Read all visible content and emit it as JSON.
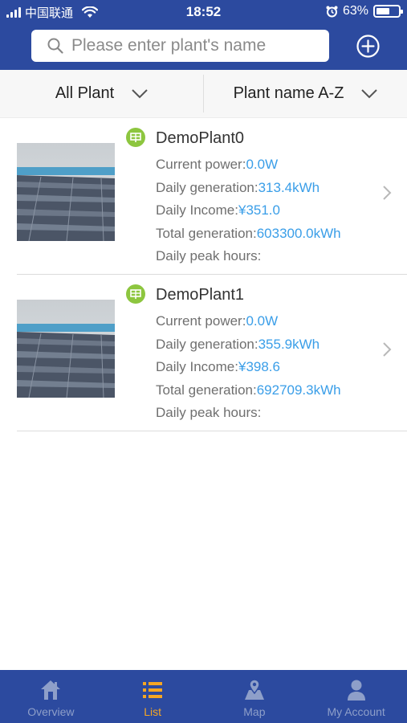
{
  "status_bar": {
    "carrier": "中国联通",
    "time": "18:52",
    "battery": "63%",
    "battery_level": 0.63
  },
  "header": {
    "search_placeholder": "Please enter plant's name",
    "add_icon": "plus-circle-icon"
  },
  "filters": {
    "type_label": "All Plant",
    "sort_label": "Plant name A-Z"
  },
  "plants": [
    {
      "name": "DemoPlant0",
      "current_power_label": "Current power:",
      "current_power": "0.0W",
      "daily_generation_label": "Daily generation:",
      "daily_generation": "313.4kWh",
      "daily_income_label": "Daily Income:",
      "daily_income": "¥351.0",
      "total_generation_label": "Total generation:",
      "total_generation": "603300.0kWh",
      "peak_hours_label": "Daily peak hours:",
      "peak_hours": ""
    },
    {
      "name": "DemoPlant1",
      "current_power_label": "Current power:",
      "current_power": "0.0W",
      "daily_generation_label": "Daily generation:",
      "daily_generation": "355.9kWh",
      "daily_income_label": "Daily Income:",
      "daily_income": "¥398.6",
      "total_generation_label": "Total generation:",
      "total_generation": "692709.3kWh",
      "peak_hours_label": "Daily peak hours:",
      "peak_hours": ""
    }
  ],
  "tabs": [
    {
      "label": "Overview",
      "icon": "home-icon",
      "active": false
    },
    {
      "label": "List",
      "icon": "list-icon",
      "active": true
    },
    {
      "label": "Map",
      "icon": "map-icon",
      "active": false
    },
    {
      "label": "My Account",
      "icon": "user-icon",
      "active": false
    }
  ],
  "colors": {
    "brand_blue": "#2c4a9f",
    "value_blue": "#3a9ee8",
    "active_tab": "#f5a623",
    "plant_icon_green": "#8dc63f"
  }
}
